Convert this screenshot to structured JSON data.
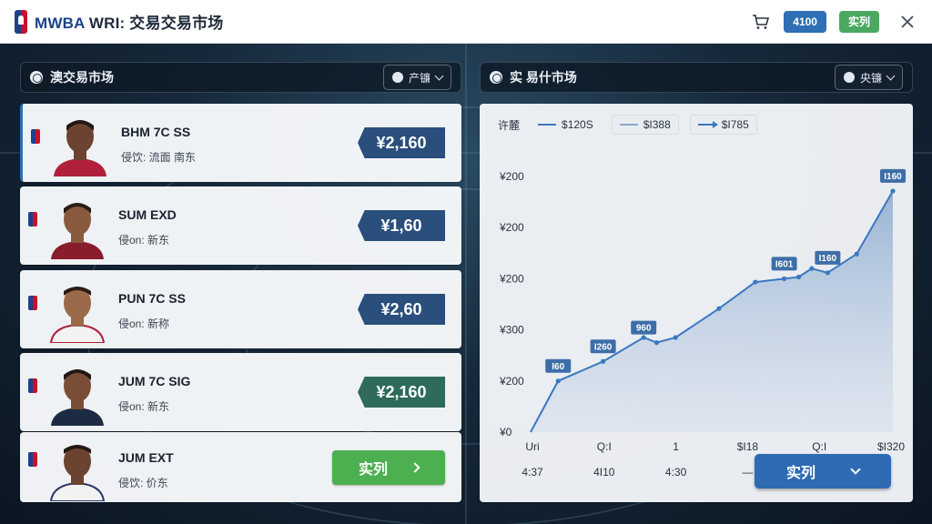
{
  "header": {
    "brand": "MWBA",
    "title_rest": " WRI: 交易交易市场",
    "points_label": "4100",
    "action_label": "实列"
  },
  "left_panel": {
    "title": "澳交易市场",
    "dropdown_label": "产镰"
  },
  "right_panel": {
    "title": "实 易什市场",
    "dropdown_label": "央镰"
  },
  "players": [
    {
      "name": "BHM 7C SS",
      "sub": "侵饮: 流面 南东",
      "price": "¥2,160",
      "tag_color": "blue"
    },
    {
      "name": "SUM EXD",
      "sub": "侵on: 新东",
      "price": "¥1,60",
      "tag_color": "blue"
    },
    {
      "name": "PUN 7C SS",
      "sub": "侵on: 新称",
      "price": "¥2,60",
      "tag_color": "blue"
    },
    {
      "name": "JUM 7C SIG",
      "sub": "侵on: 新东",
      "price": "¥2,160",
      "tag_color": "green"
    },
    {
      "name": "JUM EXT",
      "sub": "侵饮: 价东",
      "buy_label": "实列"
    }
  ],
  "chart_data": {
    "type": "line",
    "legend_label": "许麓",
    "legend": [
      "$120S",
      "$I388",
      "$I785"
    ],
    "y_tick_labels": [
      "¥200",
      "¥200",
      "¥200",
      "¥300",
      "¥200",
      "¥0"
    ],
    "x_tick_labels_top": [
      "Uri",
      "Q:I",
      "1",
      "$I18",
      "Q:I",
      "$I320"
    ],
    "x_tick_labels_bottom": [
      "4:37",
      "4I10",
      "4:30",
      "—",
      "",
      ""
    ],
    "ylim": [
      0,
      300
    ],
    "series": [
      {
        "x": [
          0,
          0.38,
          1.0,
          1.56,
          1.74,
          2.0,
          2.6,
          3.1,
          3.5,
          3.7,
          3.88,
          4.1,
          4.5,
          5.0
        ],
        "values": [
          0,
          60,
          83,
          111,
          105,
          111,
          145,
          176,
          180,
          182,
          192,
          187,
          209,
          283
        ]
      }
    ],
    "annotations": [
      {
        "label": "I60",
        "x": 0.38,
        "y": 60
      },
      {
        "label": "I260",
        "x": 1.0,
        "y": 83
      },
      {
        "label": "960",
        "x": 1.56,
        "y": 105
      },
      {
        "label": "I601",
        "x": 3.5,
        "y": 180
      },
      {
        "label": "I160",
        "x": 4.1,
        "y": 187
      },
      {
        "label": "I160",
        "x": 5.0,
        "y": 283
      }
    ],
    "grid": false,
    "legend_position": "top-left"
  },
  "footer": {
    "market_button_label": "实列"
  },
  "colors": {
    "accent": "#2f6fb5",
    "green": "#4caf50",
    "line": "#3a78c2"
  }
}
